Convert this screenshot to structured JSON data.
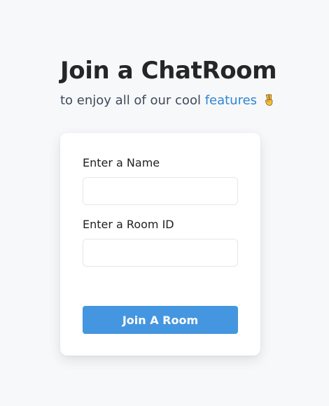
{
  "header": {
    "title": "Join a ChatRoom",
    "subtitle_prefix": "to enjoy all of our cool ",
    "subtitle_link": "features",
    "subtitle_emoji_icon": "victory-hand-icon"
  },
  "form": {
    "name_label": "Enter a Name",
    "name_value": "",
    "name_placeholder": "",
    "room_label": "Enter a Room ID",
    "room_value": "",
    "room_placeholder": "",
    "submit_label": "Join A Room"
  },
  "colors": {
    "accent": "#4596e0",
    "link": "#2e86d1",
    "background": "#f7f8fa",
    "card": "#ffffff",
    "title": "#262626"
  }
}
